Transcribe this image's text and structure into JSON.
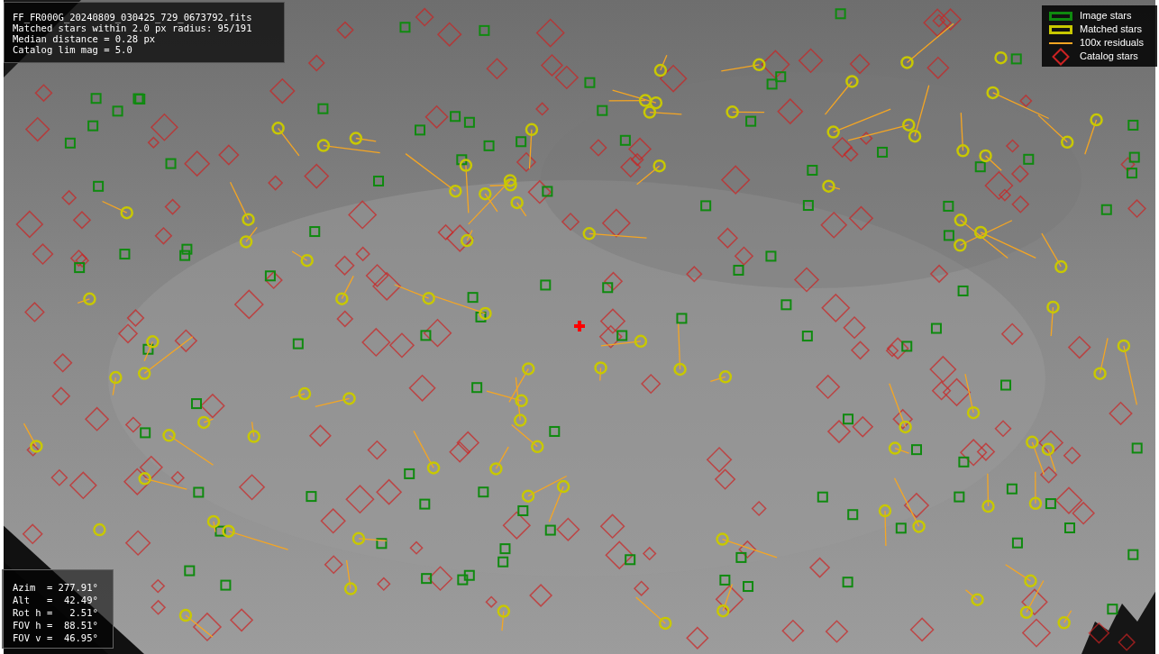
{
  "file_info": {
    "lines": [
      "FF_FR000G_20240809_030425_729_0673792.fits",
      "Matched stars within 2.0 px radius: 95/191",
      "Median distance = 0.28 px",
      "Catalog lim mag = 5.0"
    ]
  },
  "legend": [
    {
      "label": "Image stars",
      "color": "#0f8a0f"
    },
    {
      "kind": "matched",
      "label": "Matched stars",
      "color": "#c8c800"
    },
    {
      "kind": "residual",
      "label": "100x residuals",
      "color": "#f5a623"
    },
    {
      "kind": "catalog",
      "label": "Catalog stars",
      "color": "#cc2222"
    }
  ],
  "pointing": {
    "lines": [
      "Azim  = 277.91°",
      "Alt   =  42.49°",
      "Rot h =   2.51°",
      "FOV h =  88.51°",
      "FOV v =  46.95°"
    ]
  }
}
